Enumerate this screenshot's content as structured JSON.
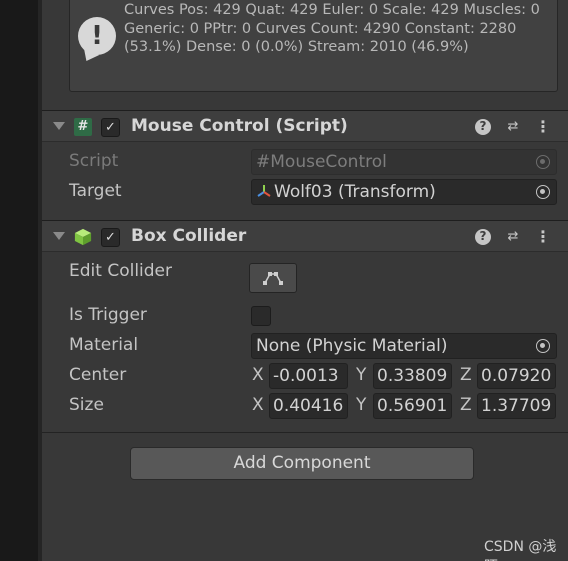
{
  "info_box": {
    "icon": "warning-exclamation-icon",
    "text": "Curves Pos: 429 Quat: 429 Euler: 0 Scale: 429 Muscles: 0 Generic: 0 PPtr: 0 Curves Count: 4290 Constant: 2280 (53.1%) Dense: 0 (0.0%) Stream: 2010 (46.9%)"
  },
  "mouse_control": {
    "icon": "csharp-script-icon",
    "icon_glyph": "#",
    "check_glyph": "✓",
    "title": "Mouse Control (Script)",
    "help_glyph": "?",
    "preset_glyph": "⇄",
    "menu_glyph": "⋮",
    "script_label": "Script",
    "script_value": "MouseControl",
    "target_label": "Target",
    "target_value": "Wolf03 (Transform)"
  },
  "box_collider": {
    "icon": "box-collider-cube-icon",
    "check_glyph": "✓",
    "title": "Box Collider",
    "help_glyph": "?",
    "preset_glyph": "⇄",
    "menu_glyph": "⋮",
    "edit_collider_label": "Edit Collider",
    "is_trigger_label": "Is Trigger",
    "is_trigger_checked": false,
    "material_label": "Material",
    "material_value": "None (Physic Material)",
    "center_label": "Center",
    "center": {
      "x_label": "X",
      "x": "-0.0013",
      "y_label": "Y",
      "y": "0.33809",
      "z_label": "Z",
      "z": "0.07920"
    },
    "size_label": "Size",
    "size": {
      "x_label": "X",
      "x": "0.40416",
      "y_label": "Y",
      "y": "0.56901",
      "z_label": "Z",
      "z": "1.37709"
    }
  },
  "add_component_label": "Add Component",
  "watermark": "CSDN @浅陌sss",
  "colors": {
    "panel": "#383838",
    "script_icon": "#2f6b46",
    "cube_icon": "#8fd14f"
  }
}
